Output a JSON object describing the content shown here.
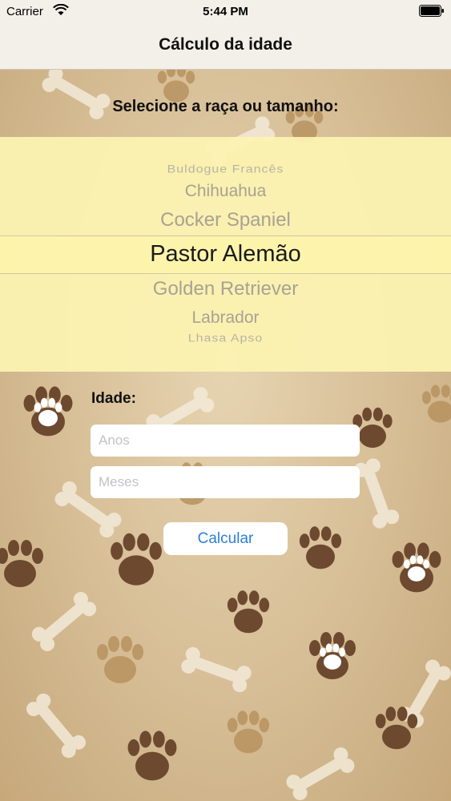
{
  "status_bar": {
    "carrier": "Carrier",
    "time": "5:44 PM"
  },
  "nav": {
    "title": "Cálculo da idade"
  },
  "breed": {
    "label": "Selecione a raça ou tamanho:",
    "options_visible": [
      "Buldogue Francês",
      "Chihuahua",
      "Cocker Spaniel",
      "Pastor Alemão",
      "Golden Retriever",
      "Labrador",
      "Lhasa Apso"
    ],
    "selected": "Pastor Alemão"
  },
  "age": {
    "label": "Idade:",
    "years_placeholder": "Anos",
    "months_placeholder": "Meses"
  },
  "calculate_button": "Calcular",
  "colors": {
    "picker_background": "#fcf3b2",
    "button_text": "#2b7fd6",
    "background": "#d8c19d"
  },
  "icons": [
    "wifi-icon",
    "battery-icon",
    "paw-print-icon",
    "bone-icon"
  ]
}
